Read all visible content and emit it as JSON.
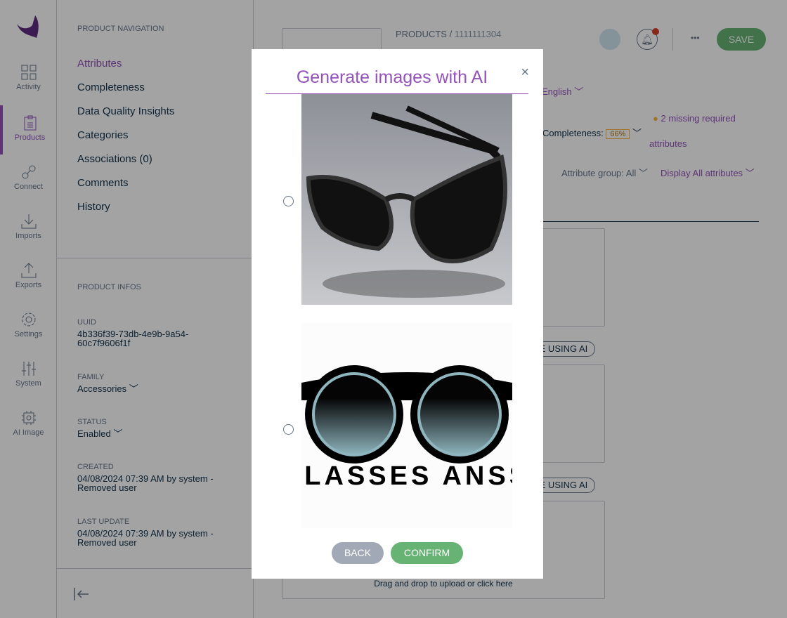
{
  "rail": {
    "items": [
      {
        "label": "Activity",
        "icon": "grid-icon"
      },
      {
        "label": "Products",
        "icon": "clipboard-icon"
      },
      {
        "label": "Connect",
        "icon": "plug-icon"
      },
      {
        "label": "Imports",
        "icon": "download-icon"
      },
      {
        "label": "Exports",
        "icon": "upload-icon"
      },
      {
        "label": "Settings",
        "icon": "gear-icon"
      },
      {
        "label": "System",
        "icon": "sliders-icon"
      },
      {
        "label": "AI Image",
        "icon": "ai-chip-icon"
      }
    ]
  },
  "panel": {
    "nav_title": "PRODUCT NAVIGATION",
    "nav": [
      "Attributes",
      "Completeness",
      "Data Quality Insights",
      "Categories",
      "Associations (0)",
      "Comments",
      "History"
    ],
    "infos_title": "PRODUCT INFOS",
    "uuid_label": "UUID",
    "uuid": "4b336f39-73db-4e9b-9a54-60c7f9606f1f",
    "family_label": "FAMILY",
    "family": "Accessories",
    "status_label": "STATUS",
    "status": "Enabled",
    "created_label": "CREATED",
    "created": "04/08/2024 07:39 AM by system - Removed user",
    "updated_label": "LAST UPDATE",
    "updated": "04/08/2024 07:39 AM by system - Removed user"
  },
  "header": {
    "breadcrumb_root": "PRODUCTS",
    "breadcrumb_sep": "/",
    "breadcrumb_id": "1111111304",
    "save": "SAVE",
    "more": "•••"
  },
  "main": {
    "locale": "English",
    "completeness_label": "Completeness:",
    "completeness": "66%",
    "missing": "2 missing required",
    "missing2": "attributes",
    "attr_group": "Attribute group: All",
    "display": "Display All attributes",
    "ai_btn": "ATE USING AI",
    "drop": "Drag and drop to upload or click here"
  },
  "modal": {
    "title": "Generate images with AI",
    "close": "×",
    "back": "BACK",
    "confirm": "CONFIRM",
    "image2_text": "SLASSES ANSS"
  },
  "colors": {
    "accent": "#9452ba",
    "save": "#67b373",
    "back": "#a1a9b7",
    "warning": "#f9b53f"
  }
}
